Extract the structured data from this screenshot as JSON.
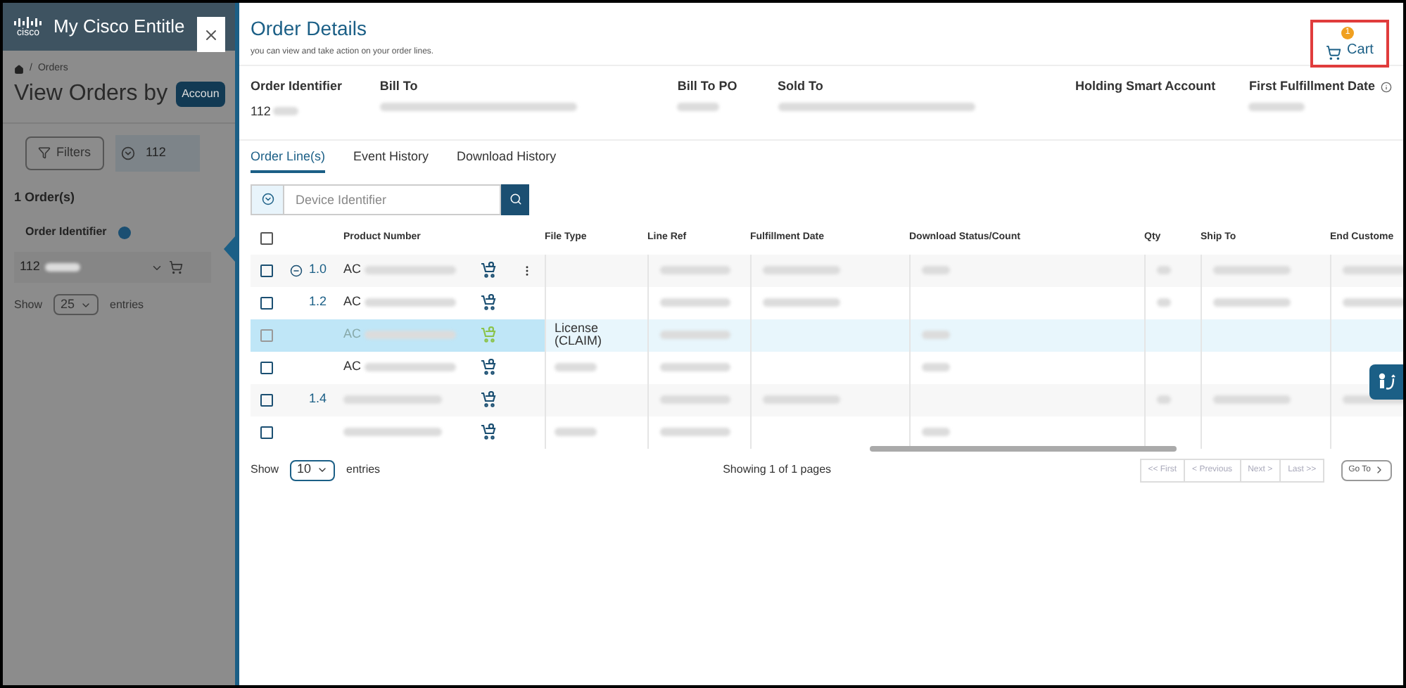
{
  "background": {
    "logo": "cisco",
    "brand": "My Cisco Entitle",
    "breadcrumb_separator": "/",
    "breadcrumb": "Orders",
    "title": "View Orders by",
    "view_button": "Accoun",
    "filters_button": "Filters",
    "search_value": "112",
    "count": "1 Order(s)",
    "column_header": "Order Identifier",
    "row_value": "112",
    "show_label": "Show",
    "page_size": "25",
    "entries_label": "entries"
  },
  "panel": {
    "title": "Order Details",
    "subtitle": "you can view and take action on your order lines.",
    "cart": {
      "label": "Cart",
      "count": "1"
    },
    "summary": [
      {
        "label": "Order Identifier",
        "value": "112"
      },
      {
        "label": "Bill To"
      },
      {
        "label": "Bill To PO"
      },
      {
        "label": "Sold To"
      },
      {
        "label": "Holding Smart Account"
      },
      {
        "label": "First Fulfillment Date",
        "info": true
      }
    ],
    "tabs": [
      {
        "label": "Order Line(s)",
        "selected": true
      },
      {
        "label": "Event History",
        "selected": false
      },
      {
        "label": "Download History",
        "selected": false
      }
    ],
    "search": {
      "placeholder": "Device Identifier"
    },
    "table": {
      "select_all": {
        "checked": false
      },
      "columns": [
        "Product Number",
        "File Type",
        "Line Ref",
        "Fulfillment Date",
        "Download Status/Count",
        "Qty",
        "Ship To",
        "End Custome"
      ],
      "rows": [
        {
          "line": "1.0",
          "product": "AC",
          "collapsible": true,
          "menu": true,
          "checked": false,
          "selected": false,
          "in_cart": false
        },
        {
          "line": "1.2",
          "product": "AC",
          "collapsible": false,
          "menu": false,
          "checked": false,
          "selected": false,
          "in_cart": false
        },
        {
          "product": "AC",
          "file_type": "License (CLAIM)",
          "collapsible": false,
          "menu": false,
          "checked": false,
          "selected": true,
          "in_cart": true
        },
        {
          "product": "AC",
          "collapsible": false,
          "menu": false,
          "checked": false,
          "selected": false,
          "in_cart": false
        },
        {
          "line": "1.4",
          "collapsible": false,
          "menu": false,
          "checked": false,
          "selected": false,
          "in_cart": false
        },
        {
          "collapsible": false,
          "menu": false,
          "checked": false,
          "selected": false,
          "in_cart": false
        }
      ]
    },
    "footer": {
      "show_label": "Show",
      "page_size": "10",
      "entries_label": "entries",
      "status": "Showing 1 of 1 pages",
      "pager": [
        {
          "label": "<< First",
          "disabled": true
        },
        {
          "label": "< Previous",
          "disabled": true
        },
        {
          "label": "Next >",
          "disabled": true
        },
        {
          "label": "Last >>",
          "disabled": true
        }
      ],
      "goto": "Go To"
    }
  }
}
